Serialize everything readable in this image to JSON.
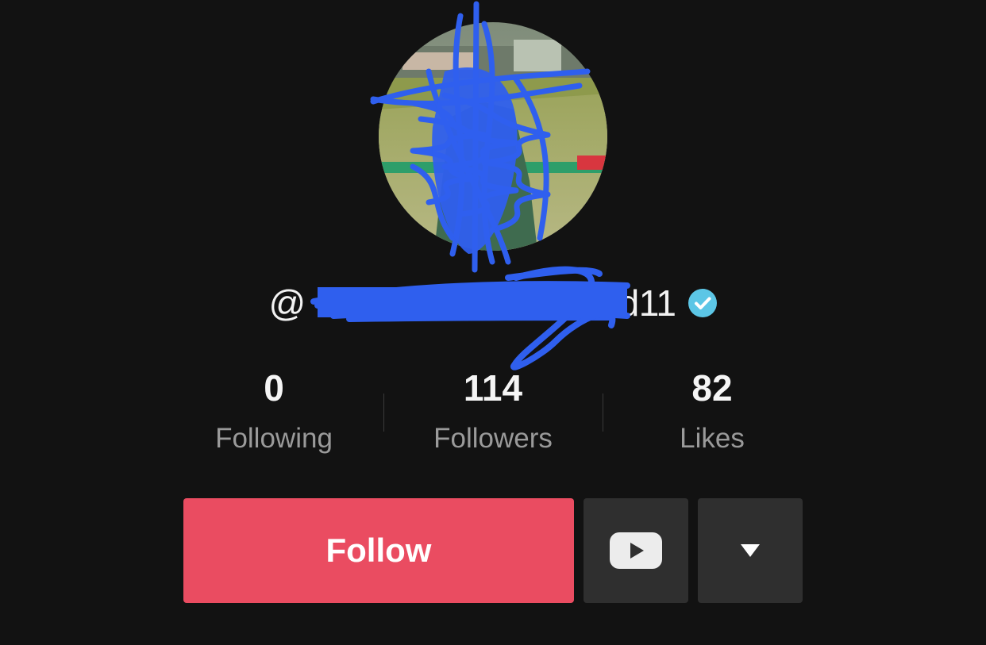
{
  "profile": {
    "username": "@",
    "username_suffix": "d11",
    "verified": true
  },
  "stats": [
    {
      "value": "0",
      "label": "Following"
    },
    {
      "value": "114",
      "label": "Followers"
    },
    {
      "value": "82",
      "label": "Likes"
    }
  ],
  "actions": {
    "follow_label": "Follow",
    "youtube_icon": "youtube-icon",
    "more_icon": "triangle-down-icon"
  },
  "colors": {
    "background": "#121212",
    "follow": "#ea4c61",
    "secondary_button": "#2f2f2f",
    "verified": "#5cc6e6",
    "redaction_scribble": "#2f5fee"
  }
}
